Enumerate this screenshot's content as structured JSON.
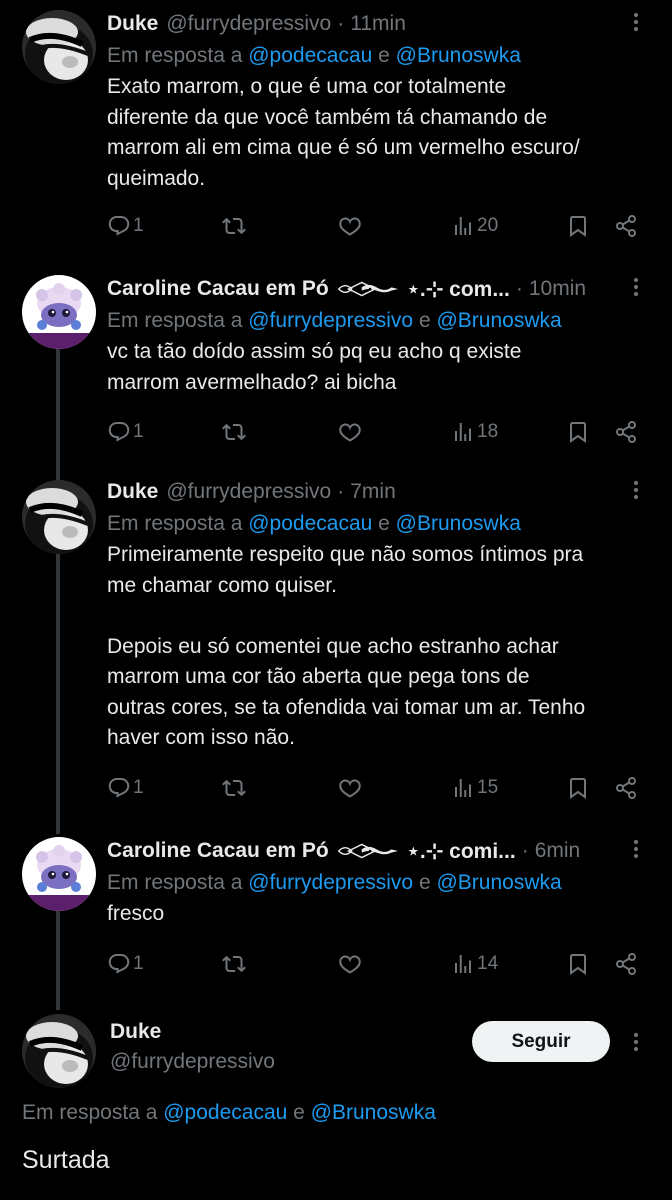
{
  "tweets": [
    {
      "name": "Duke",
      "handle": "@furrydepressivo",
      "dot": "·",
      "time": "11min",
      "reply_prefix": "Em resposta a ",
      "mention1": "@podecacau",
      "reply_and": " e ",
      "mention2": "@Brunoswka",
      "text": "Exato marrom, o que é uma cor totalmente\ndiferente da que você também tá chamando de\nmarrom ali em cima que é só um vermelho escuro/\nqueimado.",
      "replies": "1",
      "views": "20"
    },
    {
      "name": "Caroline Cacau em Pó",
      "name_suffix": "⋆.⊹ com...",
      "dot": "·",
      "time": "10min",
      "reply_prefix": "Em resposta a ",
      "mention1": "@furrydepressivo",
      "reply_and": " e ",
      "mention2": "@Brunoswka",
      "text": "vc ta tão doído assim só pq eu acho q existe\nmarrom avermelhado? ai bicha",
      "replies": "1",
      "views": "18"
    },
    {
      "name": "Duke",
      "handle": "@furrydepressivo",
      "dot": "·",
      "time": "7min",
      "reply_prefix": "Em resposta a ",
      "mention1": "@podecacau",
      "reply_and": " e ",
      "mention2": "@Brunoswka",
      "text": "Primeiramente respeito que não somos íntimos pra\nme chamar como quiser.\n\nDepois eu só comentei que acho estranho achar\nmarrom uma cor tão aberta que pega tons de\noutras cores, se ta ofendida vai tomar um ar. Tenho\nhaver com isso não.",
      "replies": "1",
      "views": "15"
    },
    {
      "name": "Caroline Cacau em Pó",
      "name_suffix": "⋆.⊹ comi...",
      "dot": "·",
      "time": "6min",
      "reply_prefix": "Em resposta a ",
      "mention1": "@furrydepressivo",
      "reply_and": " e ",
      "mention2": "@Brunoswka",
      "text": "fresco",
      "replies": "1",
      "views": "14"
    }
  ],
  "focused": {
    "name": "Duke",
    "handle": "@furrydepressivo",
    "follow_label": "Seguir",
    "reply_prefix": "Em resposta a ",
    "mention1": "@podecacau",
    "reply_and": " e ",
    "mention2": "@Brunoswka",
    "text": "Surtada"
  },
  "colors": {
    "background": "#000000",
    "text": "#e7e9ea",
    "secondary": "#71767b",
    "link": "#1d9bf0",
    "thread_line": "#333639",
    "button_bg": "#eff3f4"
  },
  "icons": [
    "reply-icon",
    "retweet-icon",
    "like-icon",
    "views-icon",
    "bookmark-icon",
    "share-icon",
    "more-icon"
  ]
}
